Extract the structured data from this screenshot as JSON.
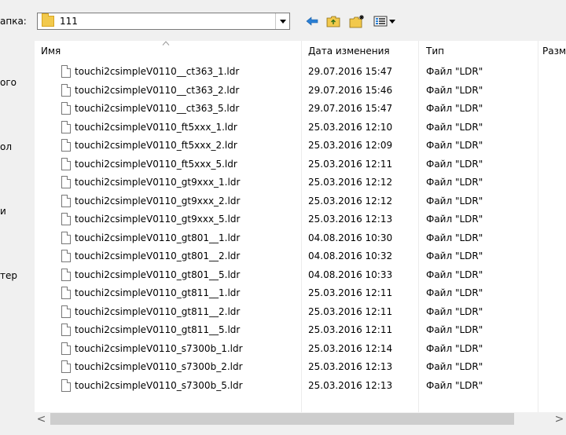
{
  "toolbar": {
    "lookin_label": "апка:",
    "current_folder": "111",
    "back_icon": "back-arrow-icon",
    "up_icon": "folder-up-icon",
    "newfolder_icon": "new-folder-icon",
    "view_icon": "view-menu-icon"
  },
  "sidebar": {
    "items": [
      {
        "label": "ого"
      },
      {
        "label": "ол"
      },
      {
        "label": "и"
      },
      {
        "label": "тер"
      }
    ]
  },
  "filelist": {
    "columns": {
      "name": "Имя",
      "date": "Дата изменения",
      "type": "Тип",
      "size": "Разм"
    },
    "files": [
      {
        "name": "touchi2csimpleV0110__ct363_1.ldr",
        "date": "29.07.2016 15:47",
        "type": "Файл \"LDR\""
      },
      {
        "name": "touchi2csimpleV0110__ct363_2.ldr",
        "date": "29.07.2016 15:46",
        "type": "Файл \"LDR\""
      },
      {
        "name": "touchi2csimpleV0110__ct363_5.ldr",
        "date": "29.07.2016 15:47",
        "type": "Файл \"LDR\""
      },
      {
        "name": "touchi2csimpleV0110_ft5xxx_1.ldr",
        "date": "25.03.2016 12:10",
        "type": "Файл \"LDR\""
      },
      {
        "name": "touchi2csimpleV0110_ft5xxx_2.ldr",
        "date": "25.03.2016 12:09",
        "type": "Файл \"LDR\""
      },
      {
        "name": "touchi2csimpleV0110_ft5xxx_5.ldr",
        "date": "25.03.2016 12:11",
        "type": "Файл \"LDR\""
      },
      {
        "name": "touchi2csimpleV0110_gt9xxx_1.ldr",
        "date": "25.03.2016 12:12",
        "type": "Файл \"LDR\""
      },
      {
        "name": "touchi2csimpleV0110_gt9xxx_2.ldr",
        "date": "25.03.2016 12:12",
        "type": "Файл \"LDR\""
      },
      {
        "name": "touchi2csimpleV0110_gt9xxx_5.ldr",
        "date": "25.03.2016 12:13",
        "type": "Файл \"LDR\""
      },
      {
        "name": "touchi2csimpleV0110_gt801__1.ldr",
        "date": "04.08.2016 10:30",
        "type": "Файл \"LDR\""
      },
      {
        "name": "touchi2csimpleV0110_gt801__2.ldr",
        "date": "04.08.2016 10:32",
        "type": "Файл \"LDR\""
      },
      {
        "name": "touchi2csimpleV0110_gt801__5.ldr",
        "date": "04.08.2016 10:33",
        "type": "Файл \"LDR\""
      },
      {
        "name": "touchi2csimpleV0110_gt811__1.ldr",
        "date": "25.03.2016 12:11",
        "type": "Файл \"LDR\""
      },
      {
        "name": "touchi2csimpleV0110_gt811__2.ldr",
        "date": "25.03.2016 12:11",
        "type": "Файл \"LDR\""
      },
      {
        "name": "touchi2csimpleV0110_gt811__5.ldr",
        "date": "25.03.2016 12:11",
        "type": "Файл \"LDR\""
      },
      {
        "name": "touchi2csimpleV0110_s7300b_1.ldr",
        "date": "25.03.2016 12:14",
        "type": "Файл \"LDR\""
      },
      {
        "name": "touchi2csimpleV0110_s7300b_2.ldr",
        "date": "25.03.2016 12:13",
        "type": "Файл \"LDR\""
      },
      {
        "name": "touchi2csimpleV0110_s7300b_5.ldr",
        "date": "25.03.2016 12:13",
        "type": "Файл \"LDR\""
      }
    ]
  },
  "scrollbar": {
    "left_arrow": "<",
    "right_arrow": ">"
  },
  "colors": {
    "folder": "#f2c94c",
    "back_arrow": "#2a7fd4"
  }
}
